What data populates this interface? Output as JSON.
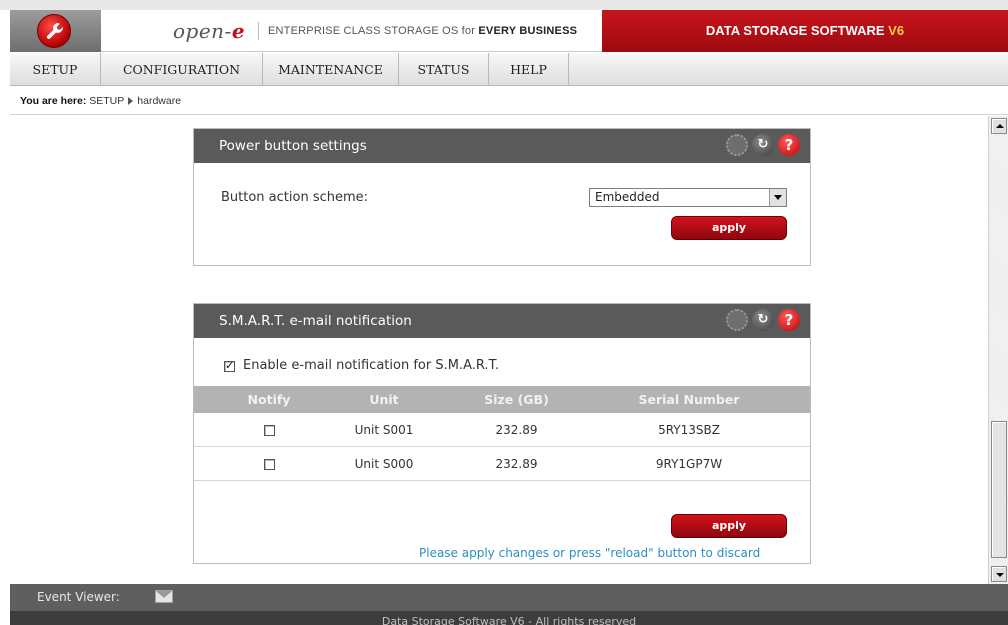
{
  "header": {
    "brand_prefix": "open-",
    "brand_suffix": "e",
    "tagline_prefix": "ENTERPRISE CLASS STORAGE OS for ",
    "tagline_bold": "EVERY BUSINESS",
    "product_name": "DATA STORAGE SOFTWARE ",
    "product_version": "V6"
  },
  "menu": {
    "items": [
      {
        "label": "SETUP"
      },
      {
        "label": "CONFIGURATION"
      },
      {
        "label": "MAINTENANCE"
      },
      {
        "label": "STATUS"
      },
      {
        "label": "HELP"
      }
    ]
  },
  "breadcrumb": {
    "prefix": "You are here:",
    "section": "SETUP",
    "page": "hardware"
  },
  "power_panel": {
    "title": "Power button settings",
    "scheme_label": "Button action scheme:",
    "scheme_value": "Embedded",
    "apply_label": "apply"
  },
  "smart_panel": {
    "title": "S.M.A.R.T. e-mail notification",
    "enable_label": "Enable e-mail notification for S.M.A.R.T.",
    "enable_checked": true,
    "columns": [
      "Notify",
      "Unit",
      "Size (GB)",
      "Serial Number"
    ],
    "rows": [
      {
        "unit": "Unit S001",
        "size": "232.89",
        "serial": "5RY13SBZ",
        "notify": false
      },
      {
        "unit": "Unit S000",
        "size": "232.89",
        "serial": "9RY1GP7W",
        "notify": false
      }
    ],
    "apply_label": "apply",
    "hint": "Please apply changes or press \"reload\" button to discard"
  },
  "footer": {
    "event_viewer_label": "Event Viewer:",
    "copyright": "Data Storage Software V6 - All rights reserved"
  },
  "colors": {
    "brand_red": "#c4121d",
    "panel_header": "#5a5a5a",
    "hint_blue": "#2a8fc4"
  }
}
